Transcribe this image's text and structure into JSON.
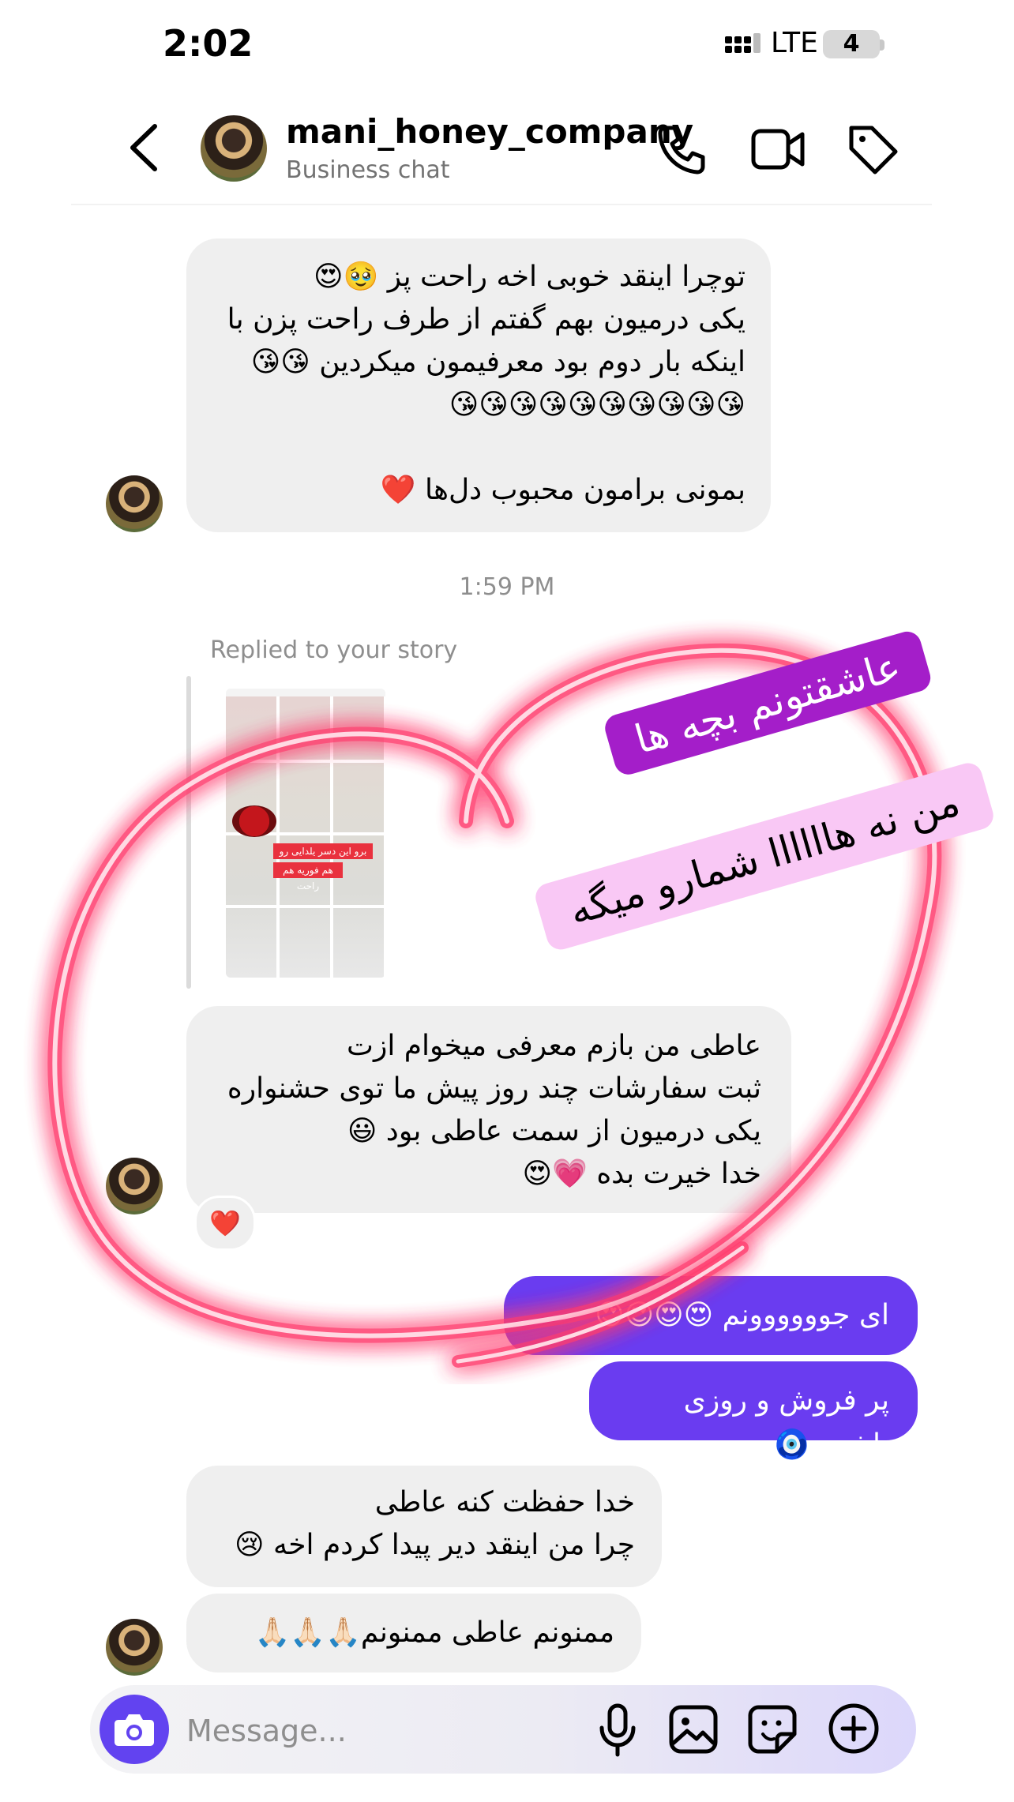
{
  "status_bar": {
    "time": "2:02",
    "network": "LTE",
    "battery": "4"
  },
  "header": {
    "name": "mani_honey_company",
    "subtitle": "Business chat"
  },
  "messages": {
    "m1": "توچرا اینقد خوبی اخه راحت پز 🥹😍\nیکی درمیون بهم گفتم از طرف راحت پزن با اینکه بار دوم بود معرفیمون میکردین 😘😘\n😘😘😘😘😘😘😘😘😘😘\n\nبمونی برامون محبوب دل‌ها ❤️",
    "timestamp": "1:59 PM",
    "replied_label": "Replied to your story",
    "story_tag_1": "برو این دسر یلدایی رو ببین اول",
    "story_tag_2": "هم فوریه هم راحت",
    "m2": "عاطی من بازم معرفی میخوام ازت\nثبت سفارشات چند روز پیش ما توی حشنواره یکی درمیون از سمت عاطی بود 😃\nخدا خیرت بده 💗😍",
    "m2_reaction": "❤️",
    "m3": "ای جوووووونم 😍😍😍😍",
    "m4": "پر فروش و روزی باشین 🧿",
    "m5": "خدا حفظت کنه عاطی\nچرا من اینقد دیر پیدا کردم اخه 😢",
    "m6": "ممنونم عاطی ممنونم🙏🏻🙏🏻🙏🏻"
  },
  "sticker": {
    "line1": "عاشقتونم بچه ها",
    "line2": "من نه هاااااا شمارو میگه"
  },
  "composer": {
    "placeholder": "Message..."
  },
  "colors": {
    "accent": "#6243f0",
    "outgoing_bubble": "#6a3cf0",
    "incoming_bubble": "#efefef",
    "sticker_purple": "#a41ec9",
    "sticker_pink": "#f9c8f5",
    "heart_glow": "#ff2d55"
  },
  "icons": [
    "back-icon",
    "phone-icon",
    "video-icon",
    "tag-icon",
    "camera-icon",
    "mic-icon",
    "gallery-icon",
    "sticker-icon",
    "plus-icon"
  ]
}
